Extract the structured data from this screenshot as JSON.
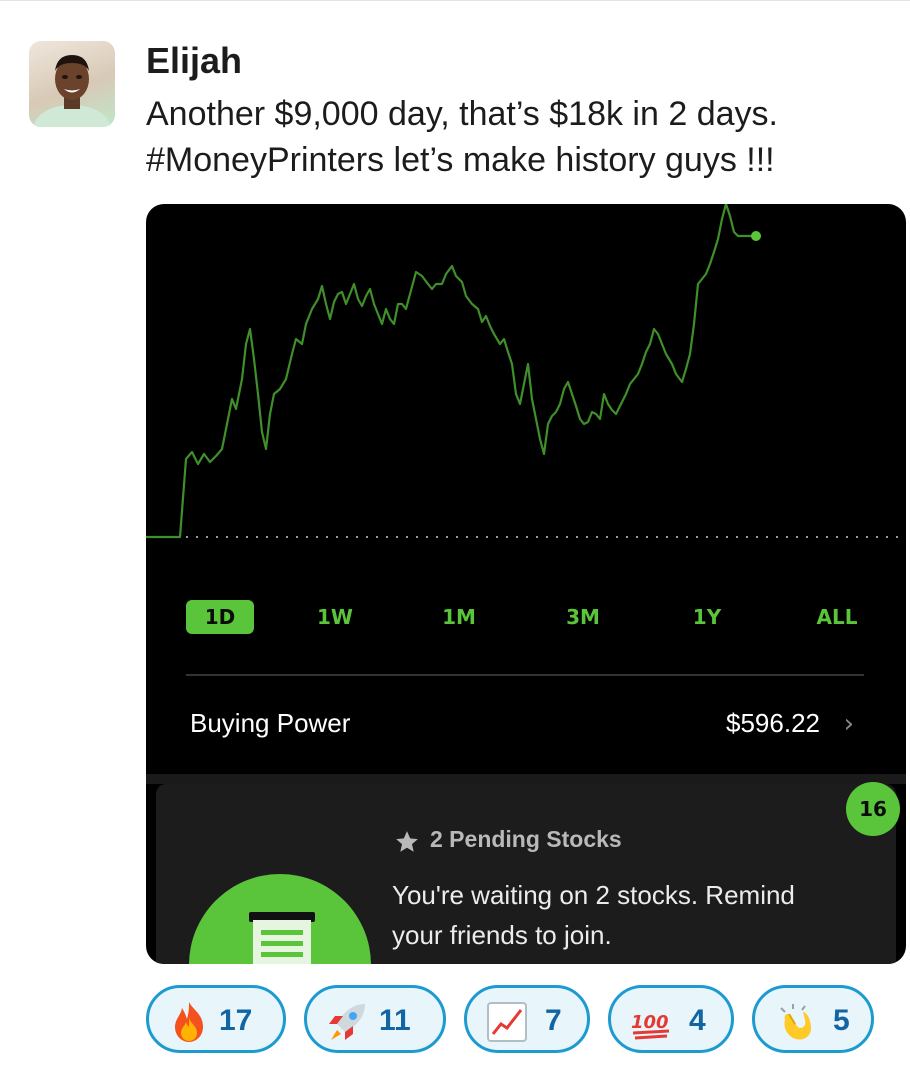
{
  "message": {
    "author": "Elijah",
    "text_line1": "Another $9,000 day, that’s $18k in 2 days.",
    "text_line2": "#MoneyPrinters let’s make history guys !!!"
  },
  "screenshot": {
    "ranges": [
      "1D",
      "1W",
      "1M",
      "3M",
      "1Y",
      "ALL"
    ],
    "selected_range": "1D",
    "buying_power_label": "Buying Power",
    "buying_power_value": "$596.22",
    "badge_count": "16",
    "pending_title": "2 Pending Stocks",
    "pending_body_line1": "You're waiting on 2 stocks. Remind",
    "pending_body_line2": "your friends to join.",
    "accent_color": "#5ac53b"
  },
  "reactions": [
    {
      "emoji": "fire",
      "count": "17"
    },
    {
      "emoji": "rocket",
      "count": "11"
    },
    {
      "emoji": "chart-increasing",
      "count": "7"
    },
    {
      "emoji": "hundred-points",
      "count": "4"
    },
    {
      "emoji": "clapping-hands",
      "count": "5"
    }
  ]
}
